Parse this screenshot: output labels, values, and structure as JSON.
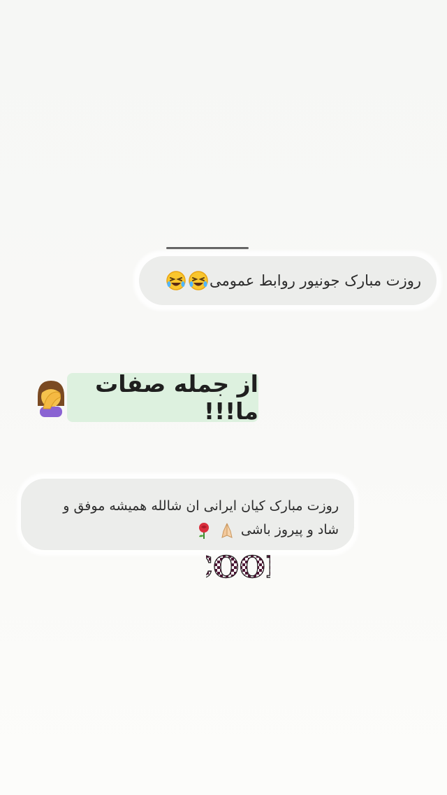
{
  "messages": [
    {
      "text": "روزت مبارک جونیور روابط عمومی",
      "emoji": [
        "rolling-laughing-face",
        "rolling-laughing-face"
      ]
    },
    {
      "text_line_1": "روزت مبارک کیان ایرانی ان شالله همیشه موفق و",
      "text_line_2": "شاد و پیروز باشی",
      "emoji": [
        "folded-hands",
        "rose"
      ]
    }
  ],
  "caption": {
    "text": "از جمله صفات ما!!!",
    "emoji": "woman-facepalming",
    "background": "#ddf1df"
  },
  "sticker": {
    "text": "COOL"
  },
  "colors": {
    "bubble": "#ecedeb",
    "background": "#f7f8f6",
    "text": "#2b2b2b"
  }
}
